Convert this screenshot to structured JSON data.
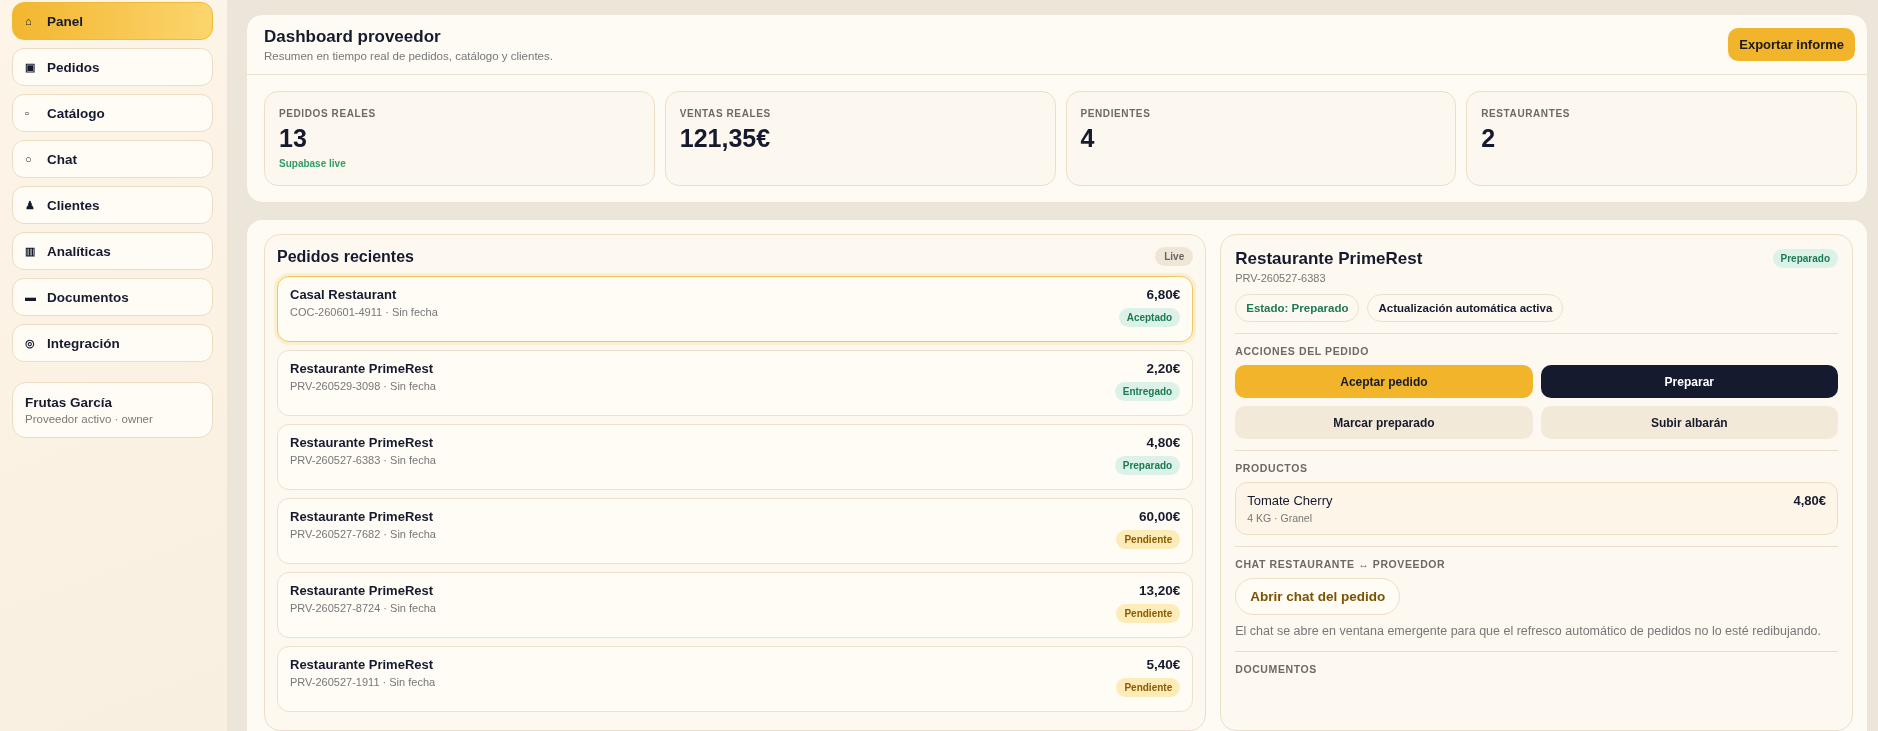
{
  "sidebar": {
    "items": [
      {
        "icon": "⌂",
        "label": "Panel",
        "selected": true
      },
      {
        "icon": "▣",
        "label": "Pedidos",
        "selected": false
      },
      {
        "icon": "▫",
        "label": "Catálogo",
        "selected": false
      },
      {
        "icon": "○",
        "label": "Chat",
        "selected": false
      },
      {
        "icon": "♟",
        "label": "Clientes",
        "selected": false
      },
      {
        "icon": "▥",
        "label": "Analíticas",
        "selected": false
      },
      {
        "icon": "▬",
        "label": "Documentos",
        "selected": false
      },
      {
        "icon": "◎",
        "label": "Integración",
        "selected": false
      }
    ],
    "account": {
      "name": "Frutas García",
      "role": "Proveedor activo · owner"
    }
  },
  "header": {
    "title": "Dashboard proveedor",
    "subtitle": "Resumen en tiempo real de pedidos, catálogo y clientes.",
    "export_button": "Exportar informe"
  },
  "stats": [
    {
      "label": "PEDIDOS REALES",
      "value": "13",
      "note": "Supabase live"
    },
    {
      "label": "VENTAS REALES",
      "value": "121,35€"
    },
    {
      "label": "PENDIENTES",
      "value": "4"
    },
    {
      "label": "RESTAURANTES",
      "value": "2"
    }
  ],
  "recent_orders": {
    "title": "Pedidos recientes",
    "badge": "Live",
    "orders": [
      {
        "name": "Casal Restaurant",
        "ref": "COC-260601-4911 · Sin fecha",
        "amount": "6,80€",
        "status": "Aceptado",
        "kind": "success",
        "selected": true
      },
      {
        "name": "Restaurante PrimeRest",
        "ref": "PRV-260529-3098 · Sin fecha",
        "amount": "2,20€",
        "status": "Entregado",
        "kind": "success",
        "selected": false
      },
      {
        "name": "Restaurante PrimeRest",
        "ref": "PRV-260527-6383 · Sin fecha",
        "amount": "4,80€",
        "status": "Preparado",
        "kind": "success",
        "selected": false
      },
      {
        "name": "Restaurante PrimeRest",
        "ref": "PRV-260527-7682 · Sin fecha",
        "amount": "60,00€",
        "status": "Pendiente",
        "kind": "warning",
        "selected": false
      },
      {
        "name": "Restaurante PrimeRest",
        "ref": "PRV-260527-8724 · Sin fecha",
        "amount": "13,20€",
        "status": "Pendiente",
        "kind": "warning",
        "selected": false
      },
      {
        "name": "Restaurante PrimeRest",
        "ref": "PRV-260527-1911 · Sin fecha",
        "amount": "5,40€",
        "status": "Pendiente",
        "kind": "warning",
        "selected": false
      }
    ]
  },
  "detail": {
    "title": "Restaurante PrimeRest",
    "ref": "PRV-260527-6383",
    "status": "Preparado",
    "chips": [
      {
        "text": "Estado: Preparado",
        "kind": "success"
      },
      {
        "text": "Actualización automática activa",
        "kind": "neutral"
      }
    ],
    "actions_heading": "ACCIONES DEL PEDIDO",
    "actions": [
      {
        "label": "Aceptar pedido",
        "kind": "primary"
      },
      {
        "label": "Preparar",
        "kind": "dark"
      },
      {
        "label": "Marcar preparado",
        "kind": "soft"
      },
      {
        "label": "Subir albarán",
        "kind": "soft"
      }
    ],
    "products_heading": "PRODUCTOS",
    "products": [
      {
        "name": "Tomate Cherry",
        "meta": "4 KG · Granel",
        "price": "4,80€"
      }
    ],
    "chat_heading": "CHAT RESTAURANTE ↔ PROVEEDOR",
    "chat_button": "Abrir chat del pedido",
    "chat_note": "El chat se abre en ventana emergente para que el refresco automático de pedidos no lo esté redibujando.",
    "documents_heading": "DOCUMENTOS"
  }
}
